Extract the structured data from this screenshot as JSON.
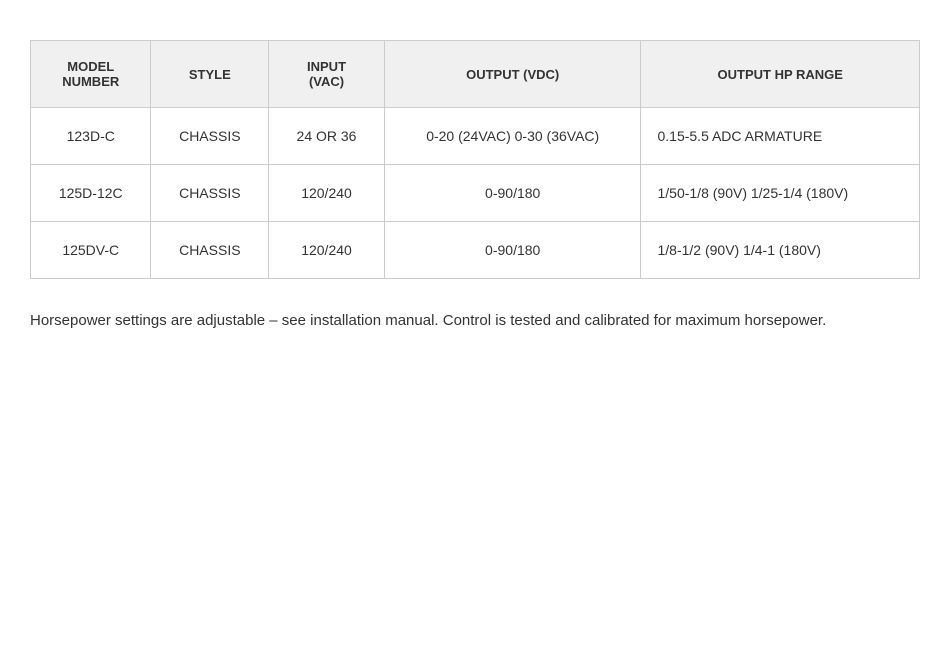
{
  "table": {
    "headers": [
      {
        "id": "model-number",
        "label": "MODEL\nNUMBER"
      },
      {
        "id": "style",
        "label": "STYLE"
      },
      {
        "id": "input-vac",
        "label": "INPUT\n(VAC)"
      },
      {
        "id": "output-vdc",
        "label": "OUTPUT (VDC)"
      },
      {
        "id": "output-hp-range",
        "label": "OUTPUT HP RANGE"
      }
    ],
    "rows": [
      {
        "model": "123D-C",
        "style": "CHASSIS",
        "input": "24 OR 36",
        "output_vdc": "0-20 (24VAC) 0-30 (36VAC)",
        "output_hp": "0.15-5.5 ADC ARMATURE"
      },
      {
        "model": "125D-12C",
        "style": "CHASSIS",
        "input": "120/240",
        "output_vdc": "0-90/180",
        "output_hp": "1/50-1/8 (90V) 1/25-1/4 (180V)"
      },
      {
        "model": "125DV-C",
        "style": "CHASSIS",
        "input": "120/240",
        "output_vdc": "0-90/180",
        "output_hp": "1/8-1/2 (90V) 1/4-1 (180V)"
      }
    ]
  },
  "footnote": "Horsepower settings are adjustable – see installation manual. Control is tested and calibrated for maximum horsepower."
}
